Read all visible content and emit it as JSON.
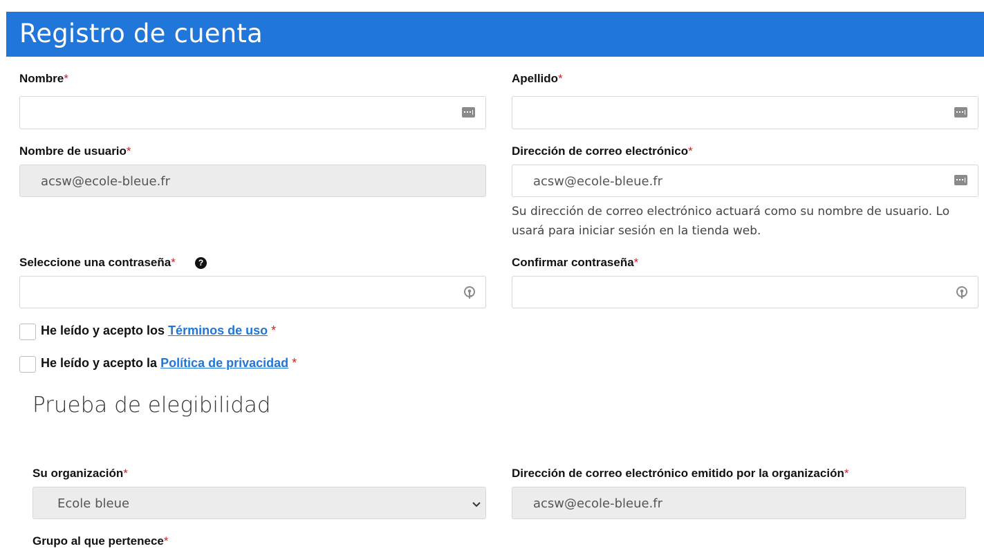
{
  "header": {
    "title": "Registro de cuenta"
  },
  "form": {
    "first_name": {
      "label": "Nombre",
      "required": "*",
      "value": ""
    },
    "last_name": {
      "label": "Apellido",
      "required": "*",
      "value": ""
    },
    "username": {
      "label": "Nombre de usuario",
      "required": "*",
      "value": "acsw@ecole-bleue.fr"
    },
    "email": {
      "label": "Dirección de correo electrónico",
      "required": "*",
      "value": "acsw@ecole-bleue.fr",
      "helper": "Su dirección de correo electrónico actuará como su nombre de usuario. Lo usará para iniciar sesión en la tienda web."
    },
    "password": {
      "label": "Seleccione una contraseña",
      "required": "*",
      "help_icon": "?"
    },
    "confirm_password": {
      "label": "Confirmar contraseña",
      "required": "*"
    },
    "terms": {
      "prefix": "He leído y acepto los ",
      "link": "Términos de uso",
      "required": " *"
    },
    "privacy": {
      "prefix": "He leído y acepto la ",
      "link": "Política de privacidad",
      "required": " *"
    }
  },
  "eligibility": {
    "title": "Prueba de elegibilidad",
    "organization": {
      "label": "Su organización",
      "required": "*",
      "selected": "Ecole bleue"
    },
    "org_email": {
      "label": "Dirección de correo electrónico emitido por la organización",
      "required": "*",
      "value": "acsw@ecole-bleue.fr"
    },
    "group": {
      "label": "Grupo al que pertenece",
      "required": "*"
    }
  },
  "colors": {
    "header_bg": "#2176d9",
    "link": "#2176d9",
    "required": "#d0201f"
  },
  "icons": {
    "field_menu": "dots-icon",
    "password_key": "key-icon",
    "help": "help-icon",
    "select": "chevron-down-icon"
  }
}
